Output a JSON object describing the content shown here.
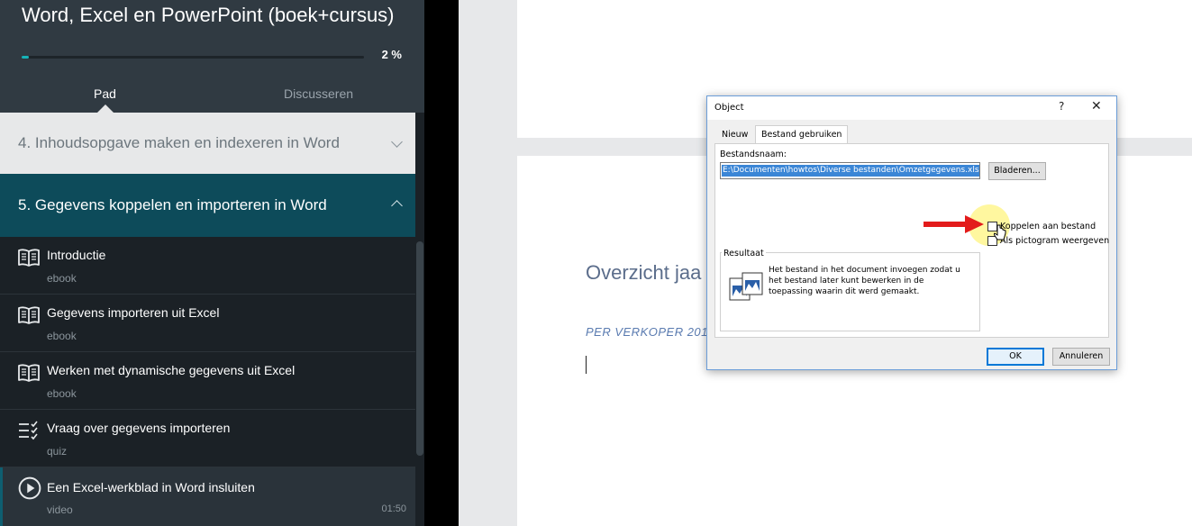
{
  "sidebar": {
    "course_title": "Word, Excel en PowerPoint (boek+cursus)",
    "progress": {
      "percent": 2,
      "label": "2 %"
    },
    "tabs": [
      {
        "label": "Pad",
        "active": true
      },
      {
        "label": "Discusseren",
        "active": false
      }
    ],
    "sections": [
      {
        "label": "4. Inhoudsopgave maken en indexeren in Word",
        "expanded": false
      },
      {
        "label": "5. Gegevens koppelen en importeren in Word",
        "expanded": true
      }
    ],
    "lessons": [
      {
        "title": "Introductie",
        "type": "ebook",
        "icon": "book-icon"
      },
      {
        "title": "Gegevens importeren uit Excel",
        "type": "ebook",
        "icon": "book-icon"
      },
      {
        "title": "Werken met dynamische gegevens uit Excel",
        "type": "ebook",
        "icon": "book-icon"
      },
      {
        "title": "Vraag over gegevens importeren",
        "type": "quiz",
        "icon": "checklist-icon"
      },
      {
        "title": "Een Excel-werkblad in Word insluiten",
        "type": "video",
        "duration": "01:50",
        "icon": "play-icon",
        "active": true
      }
    ]
  },
  "document": {
    "heading": "Overzicht jaa",
    "subheading": "PER VERKOPER 201"
  },
  "dialog": {
    "title": "Object",
    "help": "?",
    "close": "✕",
    "tabs": [
      "Nieuw",
      "Bestand gebruiken"
    ],
    "filename_label": "Bestandsnaam:",
    "filename_value": "E:\\Documenten\\howtos\\Diverse bestanden\\Omzetgegevens.xlsx",
    "browse_label": "Bladeren...",
    "link_label": "Koppelen aan bestand",
    "icon_label": "Als pictogram weergeven",
    "result_title": "Resultaat",
    "result_text": "Het bestand in het document invoegen zodat u het bestand later kunt bewerken in de toepassing waarin dit werd gemaakt.",
    "ok_label": "OK",
    "cancel_label": "Annuleren"
  },
  "colors": {
    "accent_teal": "#0d4b5a",
    "progress_fill": "#16b3b8",
    "arrow_red": "#e31b1b",
    "highlight_yellow": "#fff050"
  }
}
